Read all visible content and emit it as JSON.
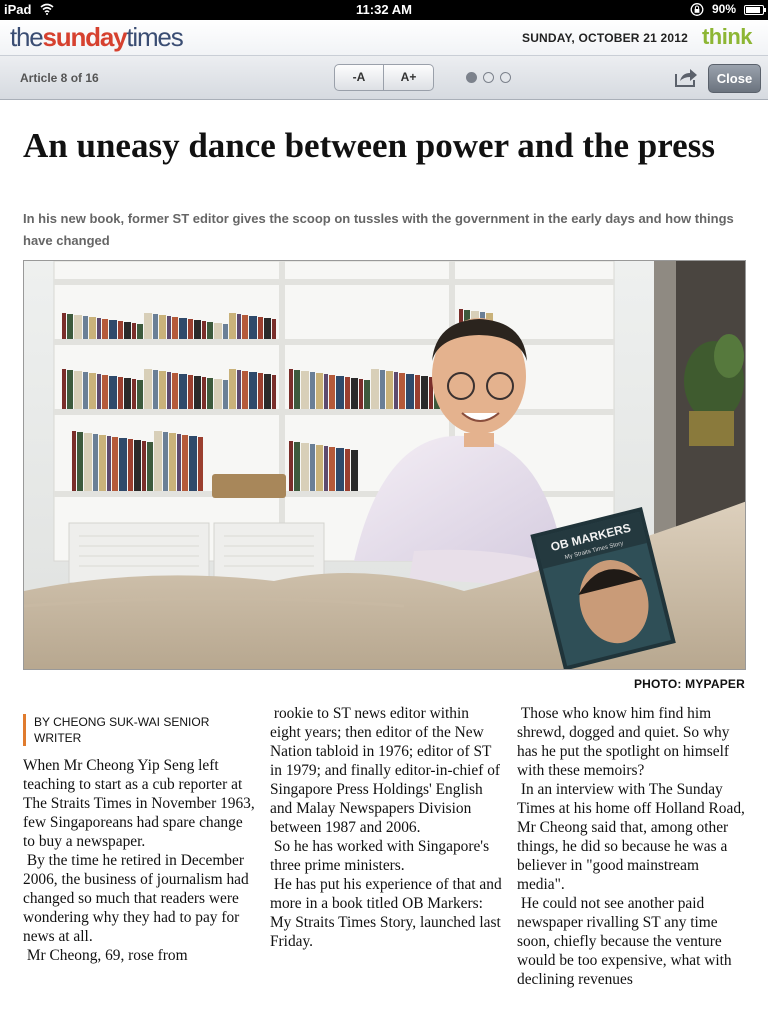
{
  "status_bar": {
    "device": "iPad",
    "time": "11:32 AM",
    "battery": "90%",
    "battery_level": 0.9
  },
  "masthead": {
    "logo": {
      "the": "the",
      "sunday": "sunday",
      "times": "times"
    },
    "date": "SUNDAY, OCTOBER 21 2012",
    "section": "think"
  },
  "toolbar": {
    "article_counter": "Article 8 of 16",
    "font_decrease": "-A",
    "font_increase": "A+",
    "pages_total": 3,
    "page_active": 1,
    "close_label": "Close"
  },
  "article": {
    "headline": "An uneasy dance between power and the press",
    "standfirst": "In his new book, former ST editor gives the scoop on tussles with the government in the early days and how things have changed",
    "photo_credit": "PHOTO: MYPAPER",
    "book_cover_title": "OB MARKERS",
    "book_cover_subtitle": "My Straits Times Story",
    "byline": "BY CHEONG SUK-WAI SENIOR WRITER",
    "column1": [
      "When Mr Cheong Yip Seng left teaching to start as a cub reporter at The Straits Times in November 1963, few Singaporeans had spare change to buy a newspaper.",
      "By the time he retired in December 2006, the business of journalism had changed so much that readers were wondering why they had to pay for news at all.",
      "Mr Cheong, 69, rose from"
    ],
    "column2": [
      "rookie to ST news editor within eight years; then editor of the New Nation tabloid in 1976; editor of ST in 1979; and finally editor-in-chief of Singapore Press Holdings' English and Malay Newspapers Division between 1987 and 2006.",
      "So he has worked with Singapore's three prime ministers.",
      "He has put his experience of that and more in a book titled OB Markers: My Straits Times Story, launched last Friday."
    ],
    "column3": [
      "Those who know him find him shrewd, dogged and quiet. So why has he put the spotlight on himself with these memoirs?",
      "In an interview with The Sunday Times at his home off Holland Road, Mr Cheong said that, among other things, he did so because he was a believer in \"good mainstream media\".",
      "He could not see another paid newspaper rivalling ST any time soon, chiefly because the venture would be too expensive, what with declining revenues"
    ]
  }
}
